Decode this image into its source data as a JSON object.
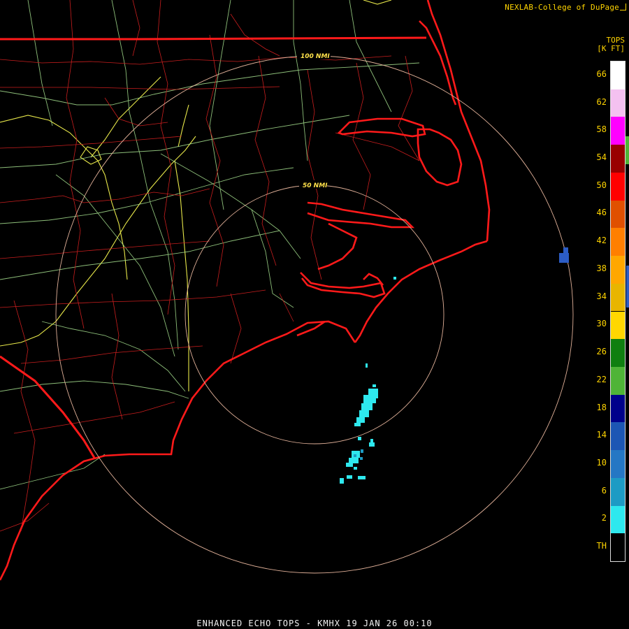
{
  "credit": "NEXLAB-College of DuPage",
  "legend": {
    "title_line1": "TOPS",
    "title_line2": "[K FT]",
    "labels": [
      "66",
      "62",
      "58",
      "54",
      "50",
      "46",
      "42",
      "38",
      "34",
      "30",
      "26",
      "22",
      "18",
      "14",
      "10",
      "6",
      "2",
      "TH"
    ],
    "colors": [
      "#ffffff",
      "#f4c1f0",
      "#ff00ff",
      "#990000",
      "#ff0000",
      "#e05000",
      "#ff7f00",
      "#ffa700",
      "#e8b500",
      "#ffd700",
      "#0f7f10",
      "#4fb437",
      "#00008b",
      "#1c56b4",
      "#2577c4",
      "#1d9bc4",
      "#2ee8ee",
      "#000000"
    ]
  },
  "rings": [
    {
      "label": "50 NMI"
    },
    {
      "label": "100 NMI"
    }
  ],
  "footer": "ENHANCED ECHO TOPS - KMHX 19 JAN 26 00:10"
}
